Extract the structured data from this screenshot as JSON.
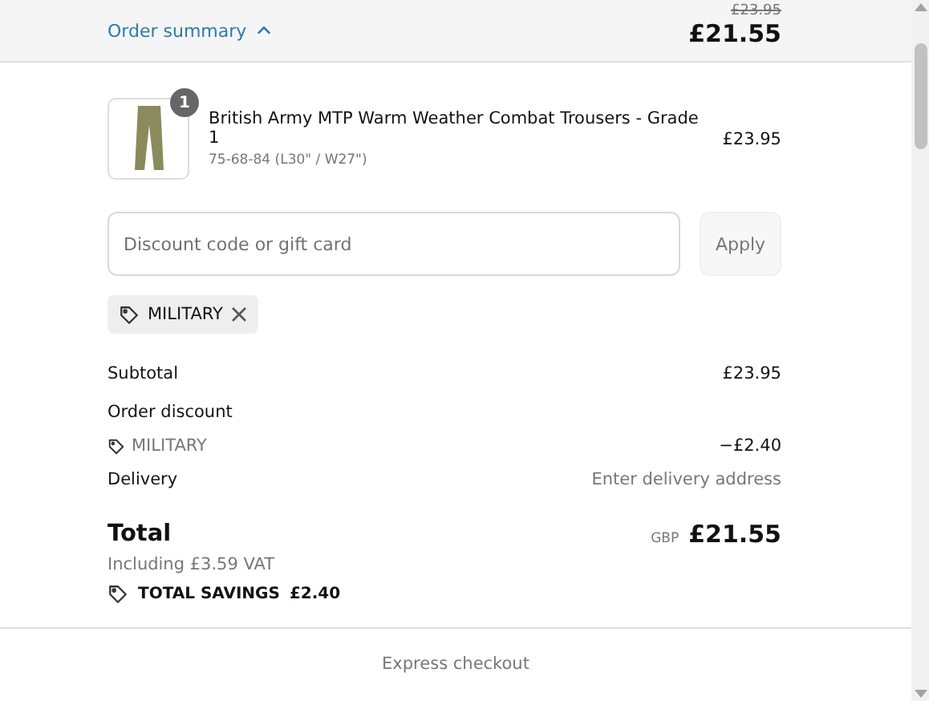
{
  "header": {
    "toggle_label": "Order summary",
    "expanded": true,
    "original_price": "£23.95",
    "price": "£21.55"
  },
  "items": [
    {
      "quantity": "1",
      "name": "British Army MTP Warm Weather Combat Trousers - Grade 1",
      "variant": "75-68-84 (L30\" / W27\")",
      "price": "£23.95"
    }
  ],
  "discount": {
    "placeholder": "Discount code or gift card",
    "button": "Apply",
    "applied_codes": [
      "MILITARY"
    ]
  },
  "summary": {
    "subtotal_label": "Subtotal",
    "subtotal": "£23.95",
    "discount_label": "Order discount",
    "discount_code": "MILITARY",
    "discount_amount": "−£2.40",
    "delivery_label": "Delivery",
    "delivery_value": "Enter delivery address"
  },
  "total": {
    "label": "Total",
    "currency": "GBP",
    "amount": "£21.55",
    "vat": "Including £3.59 VAT",
    "savings_label": "TOTAL SAVINGS",
    "savings": "£2.40"
  },
  "footer": {
    "label": "Express checkout"
  }
}
